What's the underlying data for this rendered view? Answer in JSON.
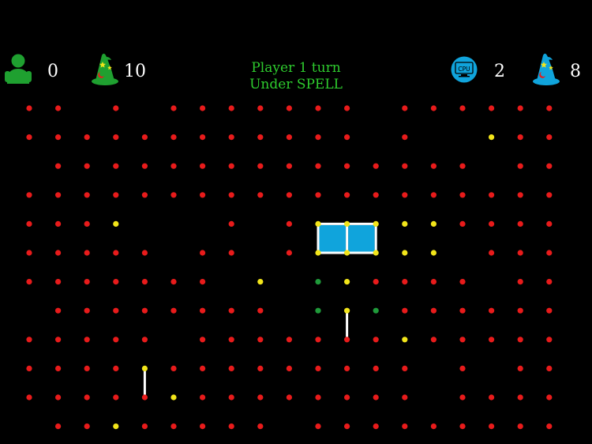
{
  "colors": {
    "background": "#000000",
    "dot": "#e81b1b",
    "selected_dot": "#f2e51a",
    "hint_dot": "#1f9a3a",
    "line": "#ffffff",
    "player1_box": "#10a4dc",
    "player_green": "#1fa030",
    "cpu_blue": "#10a4dc",
    "status_text": "#2ecc2e"
  },
  "hud": {
    "player1": {
      "icon": "person-icon",
      "score": "0",
      "spell_icon": "wizard-hat-icon",
      "spells": "10"
    },
    "cpu": {
      "icon": "cpu-icon",
      "icon_label": "CPU",
      "score": "2",
      "spell_icon": "wizard-hat-icon",
      "spells": "8"
    },
    "status_line1": "Player 1 turn",
    "status_line2": "Under SPELL"
  },
  "board": {
    "grid": [
      "11.1.1111111.111111",
      "111111111111.1..#11",
      ".111111111111111.11",
      "1111111111111111111",
      "111#...1.1#####1111",
      "11111.11.1#####.111",
      "1111111.#.G#1111.11",
      ".11111111.G#G111111",
      "11111.1111111#11111",
      "1111#111111111.1.11",
      "11111#11111111.1111",
      ".11#11111.111111111"
    ],
    "lines": [
      {
        "from": [
          10,
          4
        ],
        "to": [
          11,
          4
        ]
      },
      {
        "from": [
          11,
          4
        ],
        "to": [
          12,
          4
        ]
      },
      {
        "from": [
          10,
          5
        ],
        "to": [
          11,
          5
        ]
      },
      {
        "from": [
          11,
          5
        ],
        "to": [
          12,
          5
        ]
      },
      {
        "from": [
          10,
          4
        ],
        "to": [
          10,
          5
        ]
      },
      {
        "from": [
          11,
          4
        ],
        "to": [
          11,
          5
        ]
      },
      {
        "from": [
          12,
          4
        ],
        "to": [
          12,
          5
        ]
      },
      {
        "from": [
          11,
          7
        ],
        "to": [
          11,
          8
        ]
      },
      {
        "from": [
          4,
          9
        ],
        "to": [
          4,
          10
        ]
      }
    ],
    "boxes": [
      {
        "col": 10,
        "row": 4,
        "owner": "player1"
      },
      {
        "col": 11,
        "row": 4,
        "owner": "player1"
      }
    ]
  }
}
